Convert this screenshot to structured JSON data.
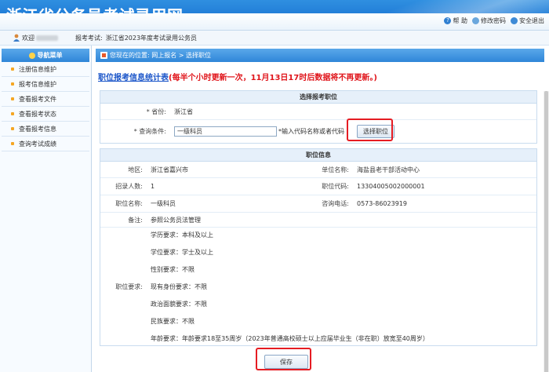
{
  "header": {
    "title": "浙江省公务员考试录用网"
  },
  "toolbar": {
    "help": "帮 助",
    "change_password": "修改密码",
    "logout": "安全退出"
  },
  "welcome": {
    "greeting": "欢迎",
    "exam_label": "报考考试:",
    "exam_name": "浙江省2023年度考试录用公务员"
  },
  "sidebar": {
    "title": "导航菜单",
    "items": [
      {
        "label": "注册信息维护"
      },
      {
        "label": "报考信息维护"
      },
      {
        "label": "查看报考文件"
      },
      {
        "label": "查看报考状态"
      },
      {
        "label": "查看报考信息"
      },
      {
        "label": "查询考试成绩"
      }
    ]
  },
  "breadcrumb": {
    "text": "您现在的位置:  网上报名  >  选择职位"
  },
  "notice": {
    "link": "职位报考信息统计表",
    "red": "(每半个小时更新一次，11月13日17时后数据将不再更新。)"
  },
  "select_section": {
    "title": "选择报考职位",
    "province_label": "* 省份:",
    "province_value": "浙江省",
    "query_label": "* 查询条件:",
    "query_value": "一级科员",
    "query_hint": "*输入代码名称或者代码",
    "select_button": "选择职位"
  },
  "position_info": {
    "title": "职位信息",
    "region_label": "地区:",
    "region_value": "浙江省嘉兴市",
    "unit_label": "单位名称:",
    "unit_value": "海盐县老干部活动中心",
    "recruit_label": "招录人数:",
    "recruit_value": "1",
    "code_label": "职位代码:",
    "code_value": "13304005002000001",
    "name_label": "职位名称:",
    "name_value": "一级科员",
    "phone_label": "咨询电话:",
    "phone_value": "0573-86023919",
    "remark_label": "备注:",
    "remark_value": "参照公务员法管理",
    "req_label": "职位要求:",
    "requirements": [
      "学历要求：本科及以上",
      "学位要求：学士及以上",
      "性别要求：不限",
      "现有身份要求：不限",
      "政治面貌要求：不限",
      "民族要求：不限",
      "年龄要求：年龄要求18至35周岁（2023年普通高校硕士以上应届毕业生（非在职）放宽至40周岁）"
    ]
  },
  "save_button": "保存",
  "colors": {
    "header_blue": "#1f7ad6",
    "highlight_red": "#e51c23",
    "link_blue": "#1a55c9",
    "notice_red": "#e0151b"
  }
}
